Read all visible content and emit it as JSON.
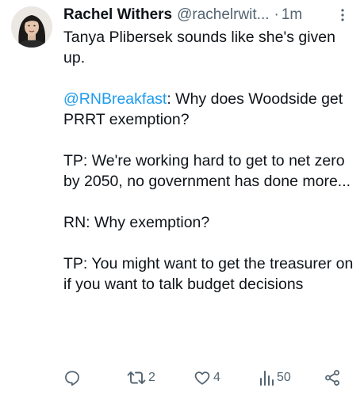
{
  "tweet": {
    "author_name": "Rachel Withers",
    "handle": "@rachelrwit...",
    "separator": "·",
    "time": "1m",
    "avatar": "profile-photo",
    "paragraphs": [
      "Tanya Plibersek sounds like she's given up.",
      null,
      "TP: We're working hard to get to net zero by 2050, no government has done more...",
      "RN: Why exemption?",
      "TP: You might want to get the treasurer on if you want to talk budget decisions"
    ],
    "mention": "@RNBreakfast",
    "mention_rest": ": Why does Woodside get PRRT exemption?"
  },
  "actions": {
    "reply_icon": "reply-icon",
    "retweet_icon": "retweet-icon",
    "retweet_count": "2",
    "like_icon": "heart-icon",
    "like_count": "4",
    "views_icon": "views-icon",
    "views_count": "50",
    "share_icon": "share-icon"
  },
  "colors": {
    "text": "#0f1419",
    "secondary": "#536471",
    "link": "#1d9bf0"
  }
}
